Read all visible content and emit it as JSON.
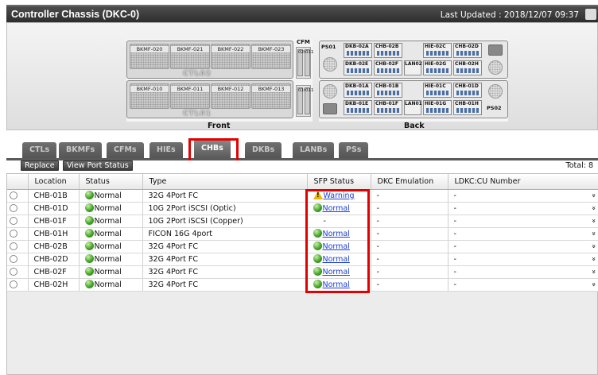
{
  "window": {
    "title": "Controller Chassis (DKC-0)",
    "last_updated": "Last Updated : 2018/12/07 09:37"
  },
  "chassis": {
    "front_label": "Front",
    "back_label": "Back",
    "cfm_label": "CFM",
    "cfm_slots": [
      "020",
      "011",
      "010",
      "011"
    ],
    "ctl_upper": "CTL02",
    "ctl_lower": "CTL01",
    "front_upper": [
      "BKMF-020",
      "BKMF-021",
      "BKMF-022",
      "BKMF-023"
    ],
    "front_lower": [
      "BKMF-010",
      "BKMF-011",
      "BKMF-012",
      "BKMF-013"
    ],
    "ps_upper": "PS01",
    "ps_lower": "PS02",
    "back_top": [
      [
        "DKB-02A",
        "CHB-02B",
        "HIE-02C",
        "CHB-02D"
      ],
      [
        "DKB-02E",
        "CHB-02F",
        "HIE-02G",
        "CHB-02H"
      ]
    ],
    "back_bottom": [
      [
        "DKB-01A",
        "CHB-01B",
        "HIE-01C",
        "CHB-01D"
      ],
      [
        "DKB-01E",
        "CHB-01F",
        "HIE-01G",
        "CHB-01H"
      ]
    ],
    "lan_upper": "LAN02",
    "lan_lower": "LAN01"
  },
  "tabs": [
    "CTLs",
    "BKMFs",
    "CFMs",
    "HIEs",
    "CHBs",
    "DKBs",
    "LANBs",
    "PSs"
  ],
  "active_tab": "CHBs",
  "toolbar": {
    "replace": "Replace",
    "view_port_status": "View Port Status",
    "total": "Total: 8"
  },
  "table": {
    "columns": [
      "Location",
      "Status",
      "Type",
      "SFP Status",
      "DKC Emulation",
      "LDKC:CU Number"
    ],
    "rows": [
      {
        "location": "CHB-01B",
        "status": "Normal",
        "type": "32G 4Port FC",
        "sfp": "Warning",
        "dkc": "-",
        "ldkc": "-"
      },
      {
        "location": "CHB-01D",
        "status": "Normal",
        "type": "10G 2Port iSCSI (Optic)",
        "sfp": "Normal",
        "dkc": "-",
        "ldkc": "-"
      },
      {
        "location": "CHB-01F",
        "status": "Normal",
        "type": "10G 2Port iSCSI (Copper)",
        "sfp": "-",
        "dkc": "-",
        "ldkc": "-"
      },
      {
        "location": "CHB-01H",
        "status": "Normal",
        "type": "FICON 16G 4port",
        "sfp": "Normal",
        "dkc": "-",
        "ldkc": "-"
      },
      {
        "location": "CHB-02B",
        "status": "Normal",
        "type": "32G 4Port FC",
        "sfp": "Normal",
        "dkc": "-",
        "ldkc": "-"
      },
      {
        "location": "CHB-02D",
        "status": "Normal",
        "type": "32G 4Port FC",
        "sfp": "Normal",
        "dkc": "-",
        "ldkc": "-"
      },
      {
        "location": "CHB-02F",
        "status": "Normal",
        "type": "32G 4Port FC",
        "sfp": "Normal",
        "dkc": "-",
        "ldkc": "-"
      },
      {
        "location": "CHB-02H",
        "status": "Normal",
        "type": "32G 4Port FC",
        "sfp": "Normal",
        "dkc": "-",
        "ldkc": "-"
      }
    ]
  },
  "colors": {
    "highlight": "#e30000",
    "link": "#1a3ed6",
    "warning": "#f0b400",
    "normal": "#3d9e22"
  }
}
